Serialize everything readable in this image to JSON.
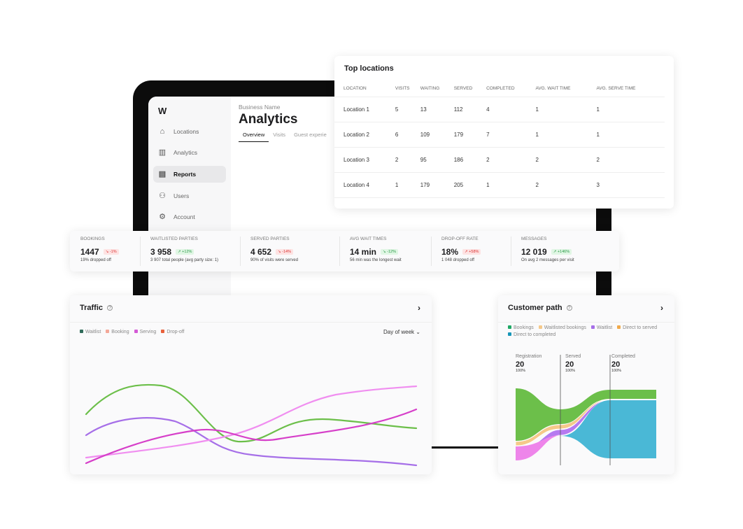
{
  "app": {
    "logo": "W",
    "business_name": "Business Name",
    "title": "Analytics",
    "tabs": [
      {
        "label": "Overview",
        "active": true
      },
      {
        "label": "Visits"
      },
      {
        "label": "Guest experie"
      }
    ]
  },
  "sidebar": {
    "items": [
      {
        "label": "Locations",
        "icon": "store-icon"
      },
      {
        "label": "Analytics",
        "icon": "bar-chart-icon"
      },
      {
        "label": "Reports",
        "icon": "document-icon",
        "active": true
      },
      {
        "label": "Users",
        "icon": "users-icon"
      },
      {
        "label": "Account",
        "icon": "gear-icon"
      }
    ]
  },
  "top_locations": {
    "title": "Top locations",
    "columns": [
      "LOCATION",
      "VISITS",
      "WAITING",
      "SERVED",
      "COMPLETED",
      "AVG. WAIT TIME",
      "AVG. SERVE TIME"
    ],
    "rows": [
      [
        "Location 1",
        "5",
        "13",
        "112",
        "4",
        "1",
        "1"
      ],
      [
        "Location 2",
        "6",
        "109",
        "179",
        "7",
        "1",
        "1"
      ],
      [
        "Location 3",
        "2",
        "95",
        "186",
        "2",
        "2",
        "2"
      ],
      [
        "Location 4",
        "1",
        "179",
        "205",
        "1",
        "2",
        "3"
      ]
    ]
  },
  "stats": [
    {
      "label": "BOOKINGS",
      "value": "1447",
      "delta": "-1%",
      "trend": "down",
      "tone": "neg",
      "sub": "19% dropped off"
    },
    {
      "label": "WAITLISTED PARTIES",
      "value": "3 958",
      "delta": "+12%",
      "trend": "up",
      "tone": "pos",
      "sub": "3 907 total people (avg party size: 1)"
    },
    {
      "label": "SERVED PARTIES",
      "value": "4 652",
      "delta": "-14%",
      "trend": "down",
      "tone": "neg",
      "sub": "90% of visits were served"
    },
    {
      "label": "AVG WAIT TIMES",
      "value": "14 min",
      "delta": "-12%",
      "trend": "down",
      "tone": "pos",
      "sub": "56 min was the longest wait"
    },
    {
      "label": "DROP-OFF RATE",
      "value": "18%",
      "delta": "+58%",
      "trend": "up",
      "tone": "neg",
      "sub": "1 048 dropped off"
    },
    {
      "label": "MESSAGES",
      "value": "12 019",
      "delta": "+146%",
      "trend": "up",
      "tone": "pos",
      "sub": "On avg 2 messages per visit"
    }
  ],
  "traffic": {
    "title": "Traffic",
    "filter": "Day of week",
    "legend": [
      {
        "label": "Waitlist",
        "color": "#2f6b5a"
      },
      {
        "label": "Booking",
        "color": "#f3a899"
      },
      {
        "label": "Serving",
        "color": "#d45ad6"
      },
      {
        "label": "Drop-off",
        "color": "#e8613c"
      }
    ],
    "line_colors": [
      "#6cbf4a",
      "#a66fe8",
      "#f08ef0",
      "#d63fc9"
    ]
  },
  "customer_path": {
    "title": "Customer path",
    "legend": [
      {
        "label": "Bookings",
        "color": "#1fa865"
      },
      {
        "label": "Waitlisted bookings",
        "color": "#f5c98a"
      },
      {
        "label": "Waitlist",
        "color": "#a66fe8"
      },
      {
        "label": "Direct to served",
        "color": "#f0a94a"
      },
      {
        "label": "Direct to completed",
        "color": "#1796b8"
      }
    ],
    "stages": [
      {
        "label": "Registration",
        "value": "20",
        "pct": "100%"
      },
      {
        "label": "Served",
        "value": "20",
        "pct": "100%"
      },
      {
        "label": "Completed",
        "value": "20",
        "pct": "100%"
      }
    ]
  }
}
